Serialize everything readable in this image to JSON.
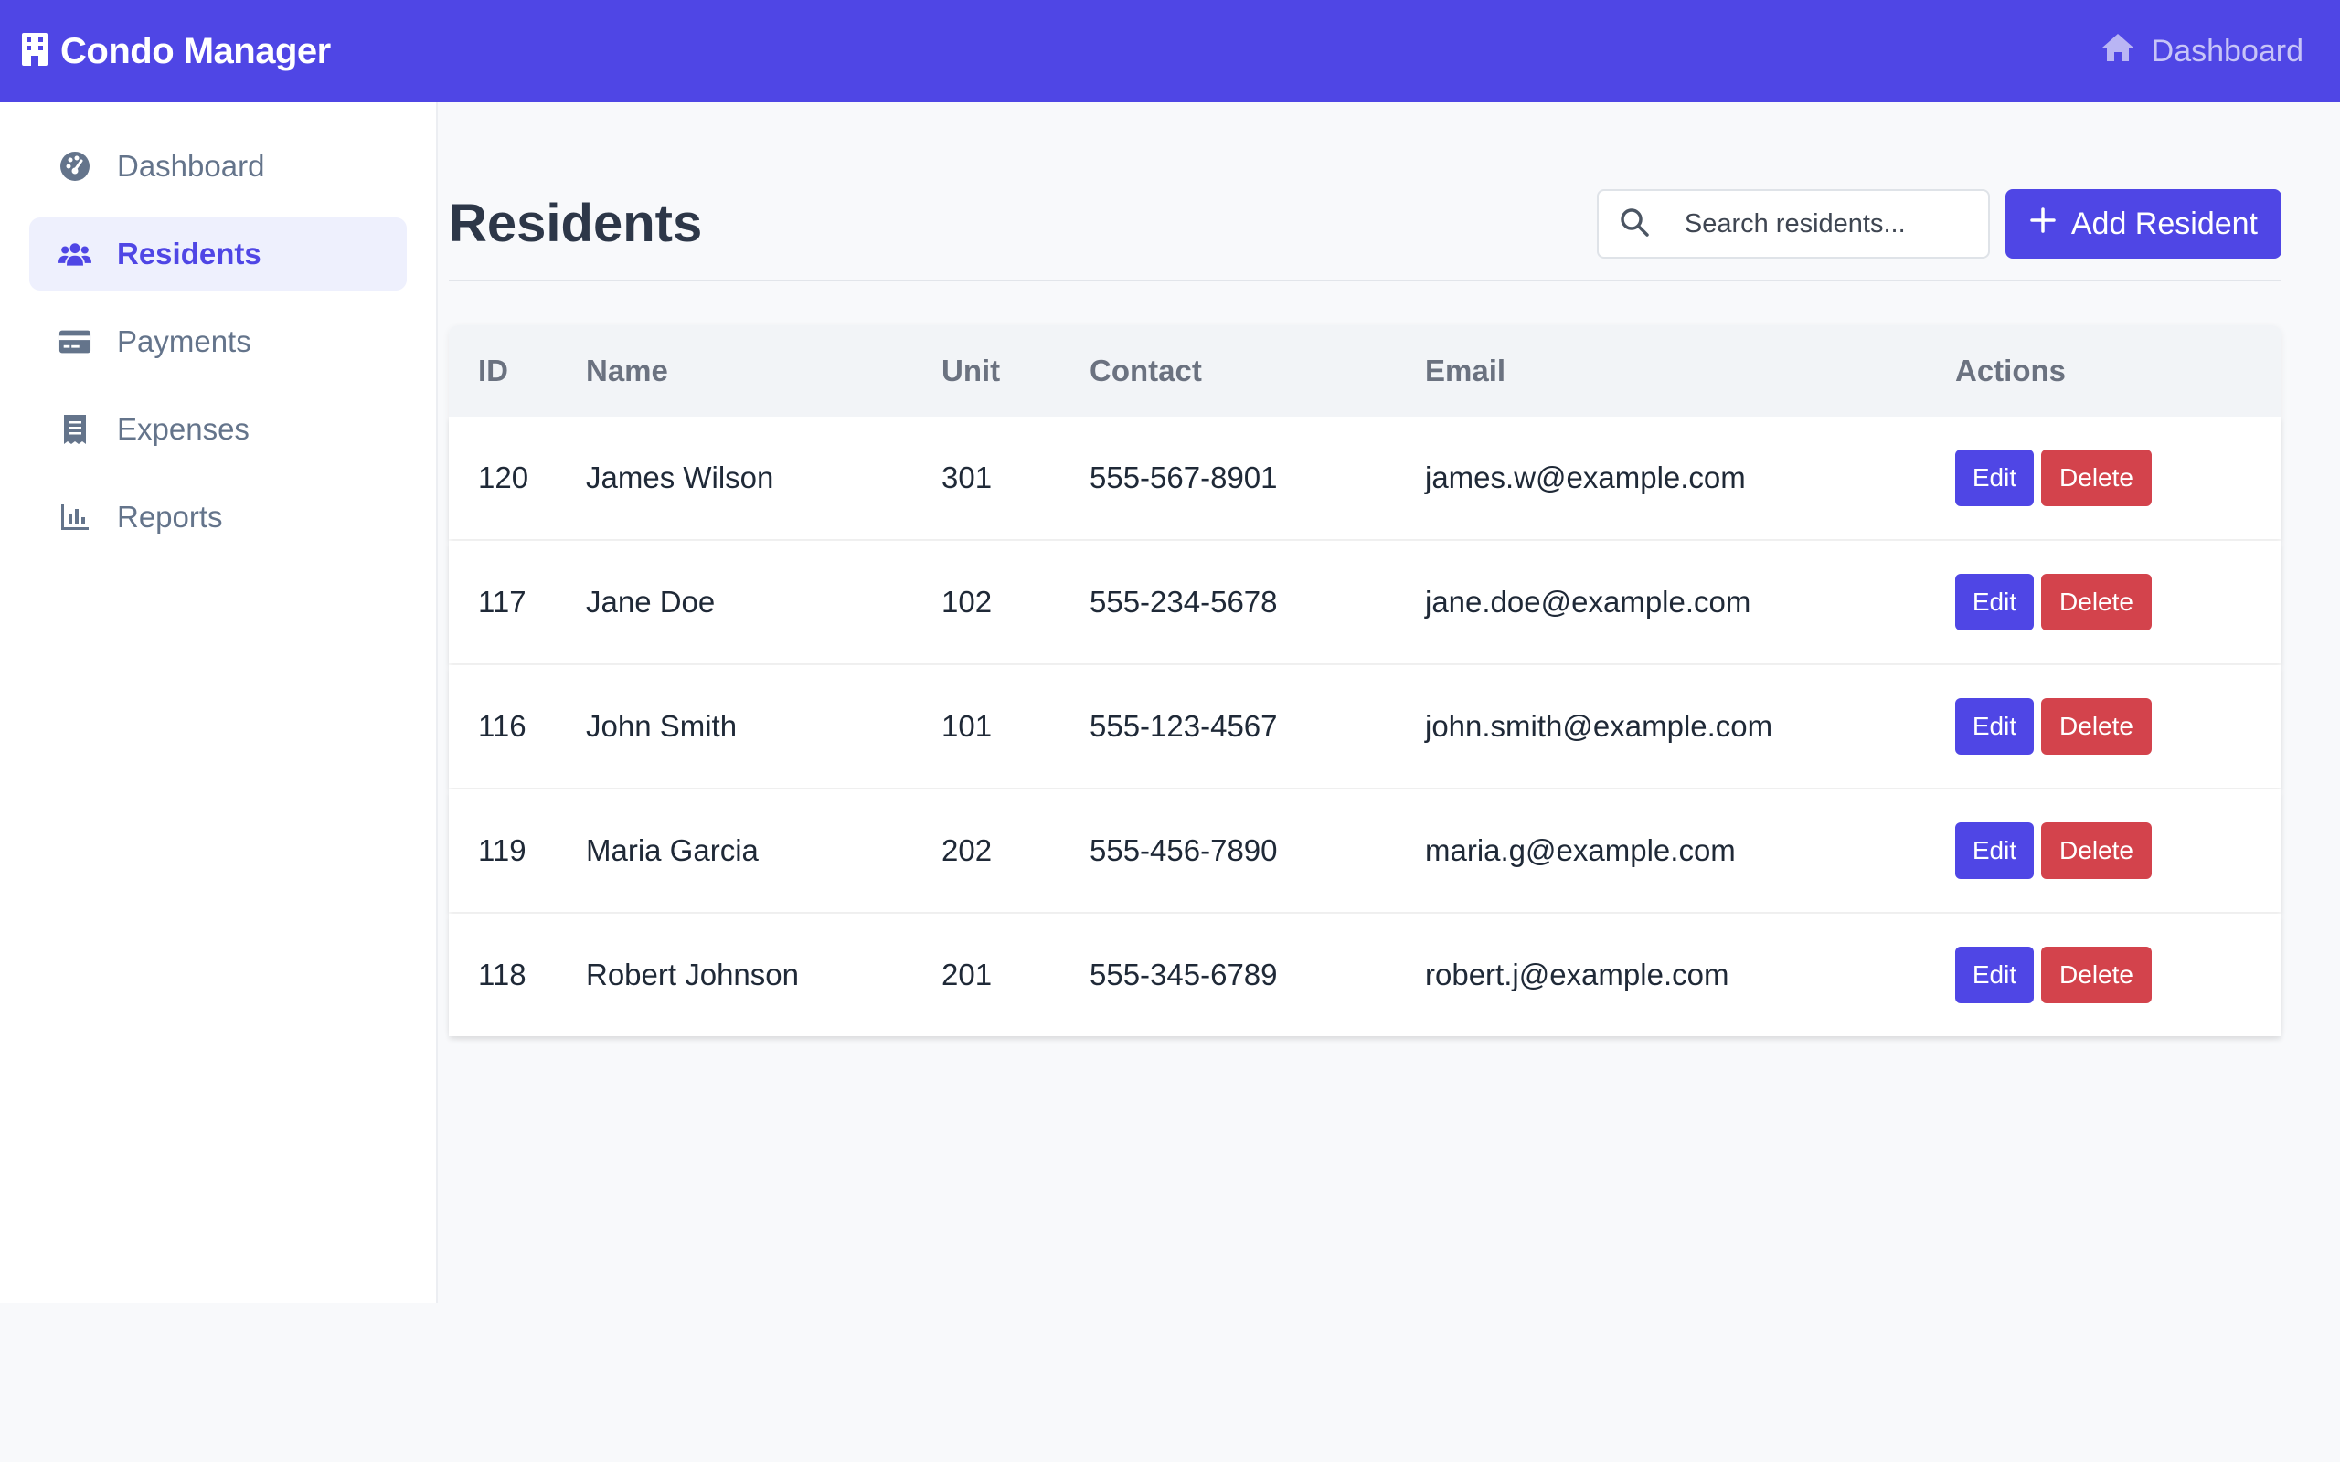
{
  "app": {
    "title": "Condo Manager"
  },
  "topnav": {
    "dashboard_label": "Dashboard"
  },
  "sidebar": {
    "items": [
      {
        "label": "Dashboard",
        "icon": "gauge-icon",
        "active": false
      },
      {
        "label": "Residents",
        "icon": "users-icon",
        "active": true
      },
      {
        "label": "Payments",
        "icon": "credit-card-icon",
        "active": false
      },
      {
        "label": "Expenses",
        "icon": "receipt-icon",
        "active": false
      },
      {
        "label": "Reports",
        "icon": "bar-chart-icon",
        "active": false
      }
    ]
  },
  "page": {
    "title": "Residents",
    "search_placeholder": "Search residents...",
    "add_button_label": "Add Resident"
  },
  "table": {
    "headers": [
      "ID",
      "Name",
      "Unit",
      "Contact",
      "Email",
      "Actions"
    ],
    "edit_label": "Edit",
    "delete_label": "Delete",
    "rows": [
      {
        "id": "120",
        "name": "James Wilson",
        "unit": "301",
        "contact": "555-567-8901",
        "email": "james.w@example.com"
      },
      {
        "id": "117",
        "name": "Jane Doe",
        "unit": "102",
        "contact": "555-234-5678",
        "email": "jane.doe@example.com"
      },
      {
        "id": "116",
        "name": "John Smith",
        "unit": "101",
        "contact": "555-123-4567",
        "email": "john.smith@example.com"
      },
      {
        "id": "119",
        "name": "Maria Garcia",
        "unit": "202",
        "contact": "555-456-7890",
        "email": "maria.g@example.com"
      },
      {
        "id": "118",
        "name": "Robert Johnson",
        "unit": "201",
        "contact": "555-345-6789",
        "email": "robert.j@example.com"
      }
    ]
  },
  "colors": {
    "primary": "#4f46e5",
    "danger": "#d3434c",
    "sidebar_active_bg": "#eef0fd"
  }
}
